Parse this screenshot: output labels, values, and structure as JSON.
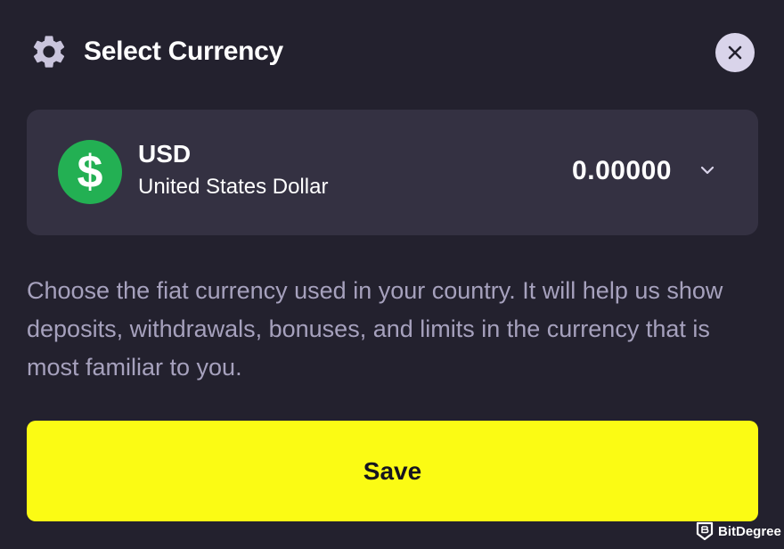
{
  "header": {
    "title": "Select Currency",
    "icon": "gear-icon",
    "close_icon": "close-icon"
  },
  "currency_selector": {
    "icon": "dollar-sign-icon",
    "icon_symbol": "$",
    "icon_color": "#23b053",
    "code": "USD",
    "name": "United States Dollar",
    "balance": "0.00000",
    "dropdown_icon": "chevron-down-icon"
  },
  "description": "Choose the fiat currency used in your country. It will help us show deposits, withdrawals, bonuses, and limits in the currency that is most familiar to you.",
  "save_button": {
    "label": "Save",
    "color": "#fbfb14"
  },
  "watermark": {
    "text": "BitDegree",
    "icon": "bitdegree-logo-icon"
  },
  "colors": {
    "background": "#23212e",
    "card": "#343142",
    "muted_text": "#a6a1bd"
  }
}
